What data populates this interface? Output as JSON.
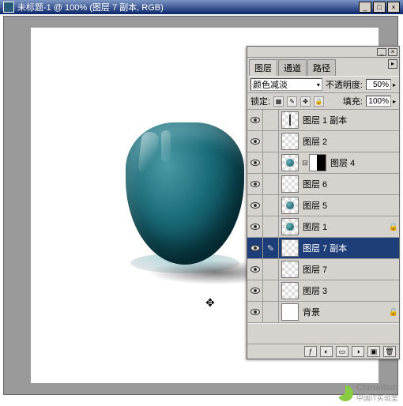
{
  "window": {
    "title": "未标题-1 @ 100% (图层 7 副本, RGB)",
    "min": "_",
    "max": "□",
    "close": "×"
  },
  "panel": {
    "tabs": [
      "图层",
      "通道",
      "路径"
    ],
    "blend_mode": "颜色减淡",
    "opacity_label": "不透明度:",
    "opacity_value": "50%",
    "lock_label": "锁定:",
    "fill_label": "填充:",
    "fill_value": "100%"
  },
  "layers": [
    {
      "name": "图层 1 副本",
      "thumb": "line"
    },
    {
      "name": "图层 2",
      "thumb": "check"
    },
    {
      "name": "图层 4",
      "thumb": "dot",
      "mask": true
    },
    {
      "name": "图层 6",
      "thumb": "check"
    },
    {
      "name": "图层 5",
      "thumb": "dot"
    },
    {
      "name": "图层 1",
      "thumb": "dot",
      "locked": true
    },
    {
      "name": "图层 7 副本",
      "thumb": "check",
      "selected": true,
      "brush": true
    },
    {
      "name": "图层 7",
      "thumb": "check"
    },
    {
      "name": "图层 3",
      "thumb": "check"
    },
    {
      "name": "背景",
      "thumb": "bg",
      "locked": true
    }
  ],
  "watermark": {
    "brand": "Chinaitlab",
    "sub": "中国IT实验室"
  }
}
